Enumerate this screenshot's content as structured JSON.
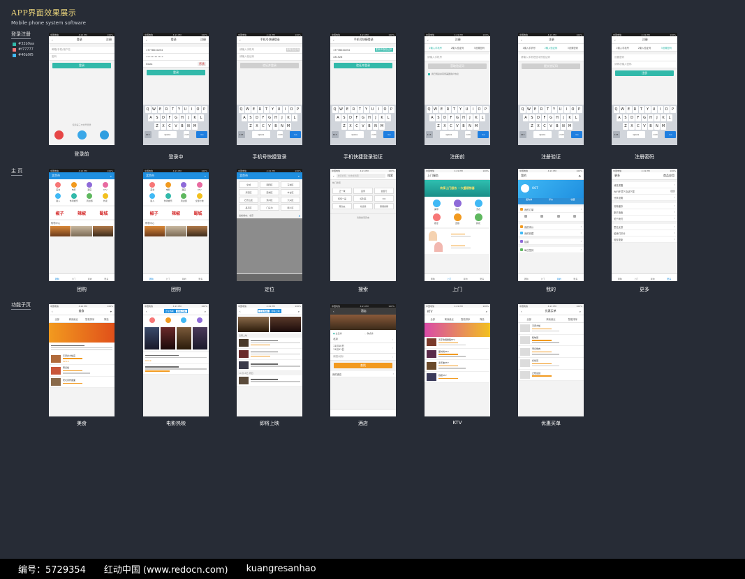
{
  "header": {
    "title": "APP界面效果展示",
    "subtitle": "Mobile phone system software"
  },
  "sections": {
    "login": "登录注册",
    "home": "主  页",
    "sub": "功能子页"
  },
  "legend": [
    {
      "label": "#32b9aa",
      "color": "#32b9aa"
    },
    {
      "label": "#f77777",
      "color": "#f77777"
    },
    {
      "label": "#40b9f5",
      "color": "#40b9f5"
    }
  ],
  "status": {
    "carrier": "中国电信",
    "time": "4:21 PM",
    "battery": "100%"
  },
  "keyboard": {
    "row1": [
      "Q",
      "W",
      "E",
      "R",
      "T",
      "Y",
      "U",
      "I",
      "O",
      "P"
    ],
    "row2": [
      "A",
      "S",
      "D",
      "F",
      "G",
      "H",
      "J",
      "K",
      "L"
    ],
    "row3": [
      "Z",
      "X",
      "C",
      "V",
      "B",
      "N",
      "M"
    ],
    "n123": "123",
    "space": "space",
    "com": ".com",
    "go": "Go"
  },
  "screens": {
    "s1": {
      "caption": "登录前",
      "nav_title": "登录",
      "nav_right": "注册",
      "field1": "邮箱/手机/用户名",
      "field2": "密码",
      "button": "登录",
      "third_party": "使用第三方帐号登录"
    },
    "s2": {
      "caption": "登录中",
      "nav_title": "登录",
      "nav_right": "注册",
      "field1": "17778040252",
      "field2": "••••••••••••",
      "captcha": "Swea",
      "button": "登录"
    },
    "s3": {
      "caption": "手机号快捷登录",
      "nav_title": "手机号快捷登录",
      "field1": "请输入手机号",
      "field1_btn": "获取验证码",
      "field2": "请输入验证码",
      "button": "验证并登录"
    },
    "s4": {
      "caption": "手机快捷登录验证",
      "nav_title": "手机号快捷登录",
      "field1": "17778040252",
      "field1_btn": "重新获取验证码",
      "field2": "431526",
      "button": "验证并登录"
    },
    "s5": {
      "caption": "注册前",
      "nav_title": "注册",
      "steps": [
        "1输入手机号",
        "2输入验证码",
        "3设置密码"
      ],
      "field1": "请输入手机号",
      "button": "获取验证码",
      "agree": "我已阅读并同意美团用户协议"
    },
    "s6": {
      "caption": "注册验证",
      "nav_title": "注册",
      "steps": [
        "1输入手机号",
        "2输入验证码",
        "3设置密码"
      ],
      "field1": "请输入手机短信中的验证码",
      "button": "提交验证码"
    },
    "s7": {
      "caption": "注册密码",
      "nav_title": "注册",
      "steps": [
        "1输入手机号",
        "2输入验证码",
        "3设置密码"
      ],
      "field1": "设置密码",
      "field2": "请再次输入密码",
      "button": "注册"
    },
    "s8": {
      "caption": "团购",
      "nav_title": "北京市",
      "icons": [
        "美食",
        "电影",
        "酒店",
        "KTV",
        "丽人",
        "休闲娱乐",
        "周边游",
        "外卖"
      ],
      "promo": [
        "椒子",
        "辣椒",
        "蜀城"
      ],
      "section": "购物中心",
      "tabs": [
        "团购",
        "上门",
        "我的",
        "更多"
      ]
    },
    "s9": {
      "caption": "团购",
      "nav_title": "北京市",
      "icons": [
        "美食",
        "电影",
        "酒店",
        "KTV",
        "丽人",
        "休闲娱乐",
        "周边游",
        "全部分类"
      ],
      "promo": [
        "椒子",
        "辣椒",
        "蜀城"
      ],
      "section": "购物中心",
      "tabs": [
        "团购",
        "上门",
        "我的",
        "更多"
      ]
    },
    "s10": {
      "caption": "定位",
      "nav_title": "北京市",
      "chips": [
        "全城",
        "朝阳区",
        "东城区",
        "海淀区",
        "西城区",
        "丰台区",
        "石景山区",
        "通州区",
        "大兴区",
        "昌平区",
        "门头沟",
        "顺义区"
      ],
      "current": "当前城市：北京"
    },
    "s11": {
      "caption": "搜索",
      "search_placeholder": "搜索商家、分类或商圈",
      "search_btn": "搜索",
      "hot_title": "热门搜索",
      "chips": [
        "正一味",
        "宜家",
        "金百万",
        "佳佳一品",
        "好利来",
        "DQ",
        "真功夫",
        "肯德基",
        "麻辣香锅"
      ],
      "history": "清除搜索历史"
    },
    "s12": {
      "caption": "上门",
      "nav_title": "上门服务",
      "banner": "欢享上门服务 一大重磅惊喜",
      "services": [
        "美甲",
        "家政",
        "洗衣",
        "推拿",
        "送餐",
        "鲜花"
      ],
      "tabs": [
        "团购",
        "上门",
        "我的",
        "更多"
      ]
    },
    "s13": {
      "caption": "我的",
      "nav_title": "我的",
      "user": "OOT",
      "stats": [
        "团购券",
        "评价",
        "收藏"
      ],
      "rows": [
        "我的订单",
        "我的评价",
        "我的收藏",
        "抽奖",
        "每日签到"
      ],
      "tabs": [
        "团购",
        "上门",
        "我的",
        "更多"
      ]
    },
    "s14": {
      "caption": "更多",
      "nav_title": "更多",
      "nav_right": "商品应用",
      "rows": [
        "消息提醒",
        "WiFi环境下自动下载",
        "分享设置",
        "清除缓存",
        "新手指南",
        "关于我们",
        "意见反馈",
        "给我们评分",
        "检查更新"
      ],
      "tabs": [
        "团购",
        "上门",
        "我的",
        "更多"
      ]
    },
    "s15": {
      "caption": "美食",
      "nav_title": "美食",
      "filters": [
        "全部",
        "离我最近",
        "智能排序",
        "筛选"
      ],
      "shops": [
        "王府井大饭店",
        "黄记煌",
        "老北京炸酱面"
      ],
      "price": "¥24.9"
    },
    "s16": {
      "caption": "电影热映",
      "tabs": [
        "正在热映",
        "即将上映"
      ],
      "cinema_price": "¥24.9"
    },
    "s17": {
      "caption": "即将上映",
      "tabs": [
        "正在热映",
        "即将上映"
      ],
      "date1": "近期上映",
      "date2": "11月18日 周四"
    },
    "s18": {
      "caption": "酒店",
      "nav_title": "酒店",
      "options": [
        "全日房",
        "钟点房"
      ],
      "city": "北京",
      "checkin": "11月10日",
      "checkout": "11月11日",
      "area": "商圈/地标",
      "button": "查找",
      "mine": "我的酒店"
    },
    "s19": {
      "caption": "KTV",
      "nav_title": "KTV",
      "filters": [
        "全部",
        "离我最近",
        "智能排序",
        "筛选"
      ],
      "shops": [
        "天宇欢唱量贩KTV",
        "星时尚KTV",
        "麦乐迪KTV",
        "钱柜KTV"
      ]
    },
    "s20": {
      "caption": "优惠买单",
      "nav_title": "优惠买单",
      "filters": [
        "全部",
        "离我最近",
        "智能排序"
      ],
      "shops": [
        "王府大饭",
        "知味观",
        "李记烤肉",
        "好伦哥",
        "正阳庄园"
      ]
    }
  },
  "footer": {
    "id": "编号：5729354",
    "site": "红动中国 (www.redocn.com)",
    "author": "kuangresanhao"
  }
}
